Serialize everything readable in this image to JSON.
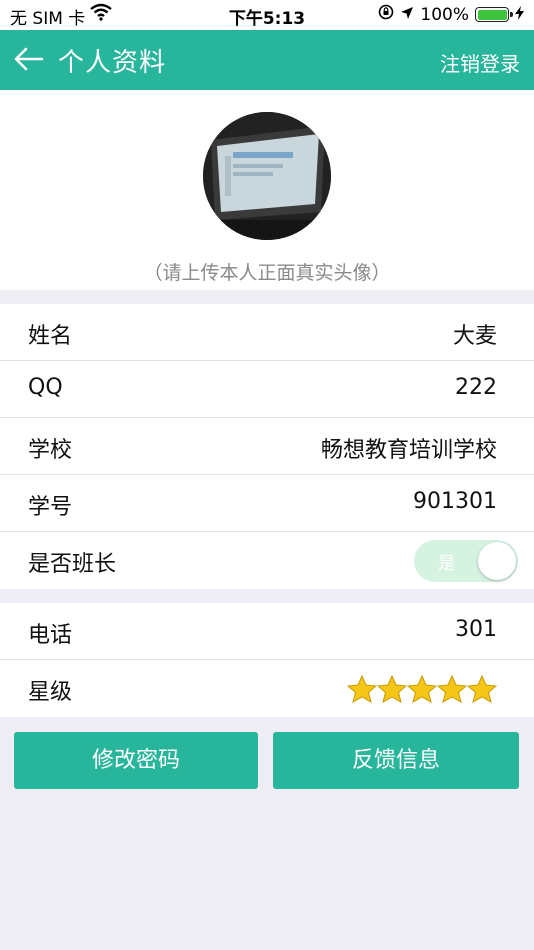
{
  "status_bar": {
    "carrier": "无 SIM 卡",
    "time": "下午5:13",
    "battery": "100%"
  },
  "nav": {
    "title": "个人资料",
    "action": "注销登录"
  },
  "avatar": {
    "hint": "（请上传本人正面真实头像）"
  },
  "profile": [
    {
      "label": "姓名",
      "value": "大麦"
    },
    {
      "label": "QQ",
      "value": "222"
    },
    {
      "label": "学校",
      "value": "畅想教育培训学校"
    },
    {
      "label": "学号",
      "value": "901301"
    },
    {
      "label": "是否班长",
      "toggle_text": "是",
      "toggle_on": true
    }
  ],
  "contact": [
    {
      "label": "电话",
      "value": "301"
    },
    {
      "label": "星级",
      "stars": 5
    }
  ],
  "buttons": {
    "change_password": "修改密码",
    "feedback": "反馈信息"
  },
  "colors": {
    "accent": "#27b59b",
    "star": "#f5c518"
  }
}
